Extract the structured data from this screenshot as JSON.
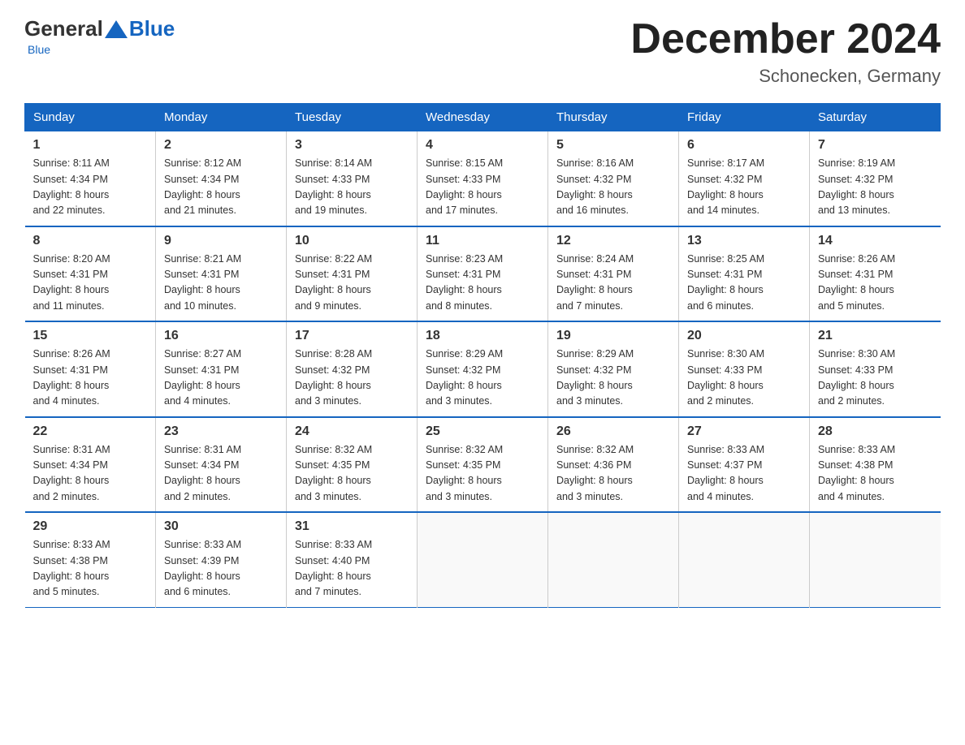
{
  "header": {
    "logo_general": "General",
    "logo_blue": "Blue",
    "month_title": "December 2024",
    "location": "Schonecken, Germany"
  },
  "days_of_week": [
    "Sunday",
    "Monday",
    "Tuesday",
    "Wednesday",
    "Thursday",
    "Friday",
    "Saturday"
  ],
  "weeks": [
    [
      {
        "day": "1",
        "sunrise": "8:11 AM",
        "sunset": "4:34 PM",
        "daylight": "8 hours and 22 minutes."
      },
      {
        "day": "2",
        "sunrise": "8:12 AM",
        "sunset": "4:34 PM",
        "daylight": "8 hours and 21 minutes."
      },
      {
        "day": "3",
        "sunrise": "8:14 AM",
        "sunset": "4:33 PM",
        "daylight": "8 hours and 19 minutes."
      },
      {
        "day": "4",
        "sunrise": "8:15 AM",
        "sunset": "4:33 PM",
        "daylight": "8 hours and 17 minutes."
      },
      {
        "day": "5",
        "sunrise": "8:16 AM",
        "sunset": "4:32 PM",
        "daylight": "8 hours and 16 minutes."
      },
      {
        "day": "6",
        "sunrise": "8:17 AM",
        "sunset": "4:32 PM",
        "daylight": "8 hours and 14 minutes."
      },
      {
        "day": "7",
        "sunrise": "8:19 AM",
        "sunset": "4:32 PM",
        "daylight": "8 hours and 13 minutes."
      }
    ],
    [
      {
        "day": "8",
        "sunrise": "8:20 AM",
        "sunset": "4:31 PM",
        "daylight": "8 hours and 11 minutes."
      },
      {
        "day": "9",
        "sunrise": "8:21 AM",
        "sunset": "4:31 PM",
        "daylight": "8 hours and 10 minutes."
      },
      {
        "day": "10",
        "sunrise": "8:22 AM",
        "sunset": "4:31 PM",
        "daylight": "8 hours and 9 minutes."
      },
      {
        "day": "11",
        "sunrise": "8:23 AM",
        "sunset": "4:31 PM",
        "daylight": "8 hours and 8 minutes."
      },
      {
        "day": "12",
        "sunrise": "8:24 AM",
        "sunset": "4:31 PM",
        "daylight": "8 hours and 7 minutes."
      },
      {
        "day": "13",
        "sunrise": "8:25 AM",
        "sunset": "4:31 PM",
        "daylight": "8 hours and 6 minutes."
      },
      {
        "day": "14",
        "sunrise": "8:26 AM",
        "sunset": "4:31 PM",
        "daylight": "8 hours and 5 minutes."
      }
    ],
    [
      {
        "day": "15",
        "sunrise": "8:26 AM",
        "sunset": "4:31 PM",
        "daylight": "8 hours and 4 minutes."
      },
      {
        "day": "16",
        "sunrise": "8:27 AM",
        "sunset": "4:31 PM",
        "daylight": "8 hours and 4 minutes."
      },
      {
        "day": "17",
        "sunrise": "8:28 AM",
        "sunset": "4:32 PM",
        "daylight": "8 hours and 3 minutes."
      },
      {
        "day": "18",
        "sunrise": "8:29 AM",
        "sunset": "4:32 PM",
        "daylight": "8 hours and 3 minutes."
      },
      {
        "day": "19",
        "sunrise": "8:29 AM",
        "sunset": "4:32 PM",
        "daylight": "8 hours and 3 minutes."
      },
      {
        "day": "20",
        "sunrise": "8:30 AM",
        "sunset": "4:33 PM",
        "daylight": "8 hours and 2 minutes."
      },
      {
        "day": "21",
        "sunrise": "8:30 AM",
        "sunset": "4:33 PM",
        "daylight": "8 hours and 2 minutes."
      }
    ],
    [
      {
        "day": "22",
        "sunrise": "8:31 AM",
        "sunset": "4:34 PM",
        "daylight": "8 hours and 2 minutes."
      },
      {
        "day": "23",
        "sunrise": "8:31 AM",
        "sunset": "4:34 PM",
        "daylight": "8 hours and 2 minutes."
      },
      {
        "day": "24",
        "sunrise": "8:32 AM",
        "sunset": "4:35 PM",
        "daylight": "8 hours and 3 minutes."
      },
      {
        "day": "25",
        "sunrise": "8:32 AM",
        "sunset": "4:35 PM",
        "daylight": "8 hours and 3 minutes."
      },
      {
        "day": "26",
        "sunrise": "8:32 AM",
        "sunset": "4:36 PM",
        "daylight": "8 hours and 3 minutes."
      },
      {
        "day": "27",
        "sunrise": "8:33 AM",
        "sunset": "4:37 PM",
        "daylight": "8 hours and 4 minutes."
      },
      {
        "day": "28",
        "sunrise": "8:33 AM",
        "sunset": "4:38 PM",
        "daylight": "8 hours and 4 minutes."
      }
    ],
    [
      {
        "day": "29",
        "sunrise": "8:33 AM",
        "sunset": "4:38 PM",
        "daylight": "8 hours and 5 minutes."
      },
      {
        "day": "30",
        "sunrise": "8:33 AM",
        "sunset": "4:39 PM",
        "daylight": "8 hours and 6 minutes."
      },
      {
        "day": "31",
        "sunrise": "8:33 AM",
        "sunset": "4:40 PM",
        "daylight": "8 hours and 7 minutes."
      },
      null,
      null,
      null,
      null
    ]
  ],
  "sunrise_label": "Sunrise:",
  "sunset_label": "Sunset:",
  "daylight_label": "Daylight:"
}
